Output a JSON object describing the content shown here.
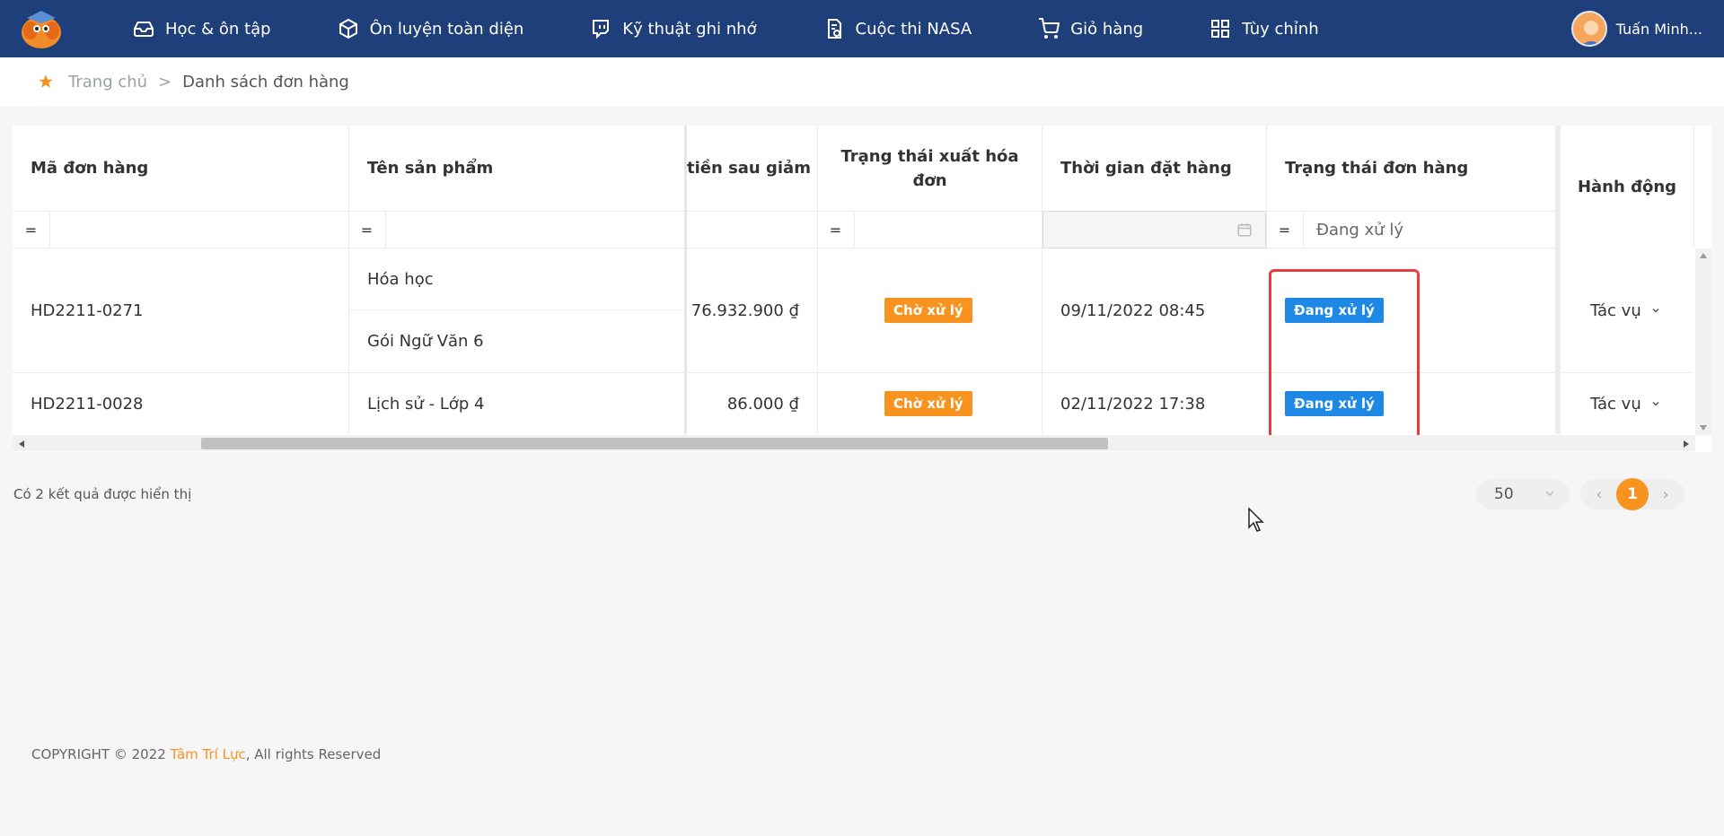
{
  "nav": {
    "items": [
      {
        "label": "Học & ôn tập",
        "icon": "inbox-icon"
      },
      {
        "label": "Ôn luyện toàn diện",
        "icon": "box-icon"
      },
      {
        "label": "Kỹ thuật ghi nhớ",
        "icon": "twitch-icon"
      },
      {
        "label": "Cuộc thi NASA",
        "icon": "document-icon"
      },
      {
        "label": "Giỏ hàng",
        "icon": "cart-icon"
      },
      {
        "label": "Tùy chỉnh",
        "icon": "grid-icon"
      }
    ],
    "user_name": "Tuấn Minh..."
  },
  "breadcrumb": {
    "home": "Trang chủ",
    "separator": ">",
    "current": "Danh sách đơn hàng"
  },
  "table": {
    "headers": {
      "order_code": "Mã đơn hàng",
      "product": "Tên sản phẩm",
      "amount": "tiền sau giảm",
      "invoice_status_l1": "Trạng thái xuất hóa",
      "invoice_status_l2": "đơn",
      "order_time": "Thời gian đặt hàng",
      "order_status": "Trạng thái đơn hàng",
      "action": "Hành động"
    },
    "filters": {
      "eq": "=",
      "order_status_value": "Đang xử lý"
    },
    "rows": [
      {
        "code": "HD2211-0271",
        "products": [
          "Hóa học",
          "Gói Ngữ Văn 6"
        ],
        "amount": "76.932.900 ₫",
        "invoice": "Chờ xử lý",
        "time": "09/11/2022 08:45",
        "status": "Đang xử lý",
        "action": "Tác vụ"
      },
      {
        "code": "HD2211-0028",
        "products": [
          "Lịch sử - Lớp 4"
        ],
        "amount": "86.000 ₫",
        "invoice": "Chờ xử lý",
        "time": "02/11/2022 17:38",
        "status": "Đang xử lý",
        "action": "Tác vụ"
      }
    ]
  },
  "results_text": "Có 2 kết quả được hiển thị",
  "pagination": {
    "page_size": "50",
    "current_page": "1",
    "prev": "‹",
    "next": "›"
  },
  "footer": {
    "prefix": "COPYRIGHT © 2022 ",
    "brand": "Tâm Trí Lực",
    "suffix": ", All rights Reserved"
  },
  "colors": {
    "nav_bg": "#1f3f7a",
    "accent": "#f7931e",
    "status_blue": "#1e88e5",
    "highlight": "#e53e3e"
  }
}
